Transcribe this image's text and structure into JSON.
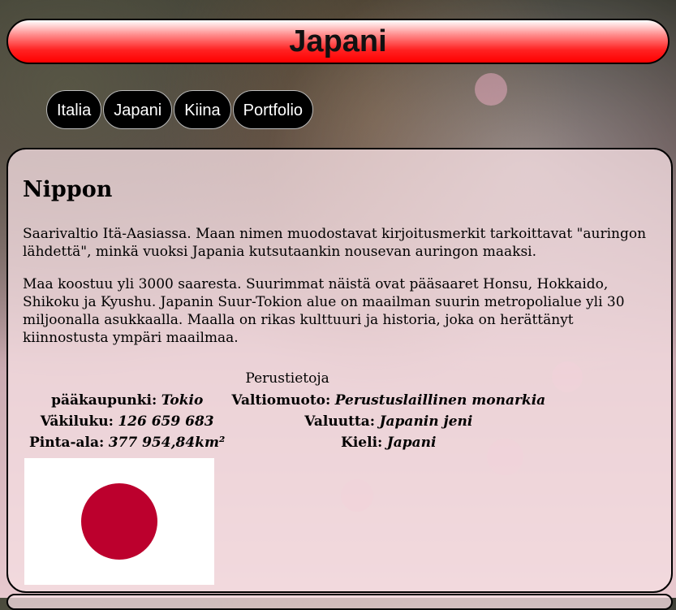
{
  "header": {
    "title": "Japani"
  },
  "nav": {
    "items": [
      "Italia",
      "Japani",
      "Kiina",
      "Portfolio"
    ]
  },
  "article": {
    "heading": "Nippon",
    "paragraphs": [
      "Saarivaltio Itä-Aasiassa. Maan nimen muodostavat kirjoitusmerkit tarkoittavat \"auringon lähdettä\", minkä vuoksi Japania kutsutaankin nousevan auringon maaksi.",
      "Maa koostuu yli 3000 saaresta. Suurimmat näistä ovat pääsaaret Honsu, Hokkaido, Shikoku ja Kyushu. Japanin Suur-Tokion alue on maailman suurin metropolialue yli 30 miljoonalla asukkaalla. Maalla on rikas kulttuuri ja historia, joka on herättänyt kiinnostusta ympäri maailmaa."
    ]
  },
  "facts": {
    "caption": "Perustietoja",
    "rows": [
      [
        {
          "label": "pääkaupunki:",
          "value": "Tokio"
        },
        {
          "label": "Valtiomuoto:",
          "value": "Perustuslaillinen monarkia"
        }
      ],
      [
        {
          "label": "Väkiluku:",
          "value": "126 659 683"
        },
        {
          "label": "Valuutta:",
          "value": "Japanin jeni"
        }
      ],
      [
        {
          "label": "Pinta-ala:",
          "value": "377 954,84km²"
        },
        {
          "label": "Kieli:",
          "value": "Japani"
        }
      ]
    ]
  },
  "flag": {
    "icon": "japan-flag-icon",
    "field_color": "#ffffff",
    "disc_color": "#bc002d"
  }
}
